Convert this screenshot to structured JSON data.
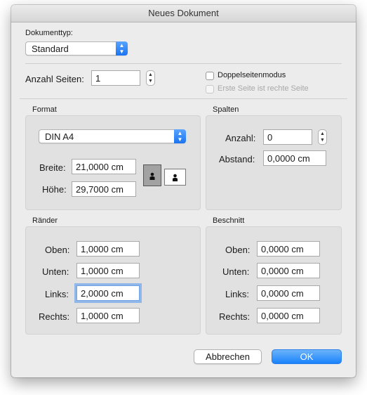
{
  "window": {
    "title": "Neues Dokument"
  },
  "doc_type": {
    "label": "Dokumenttyp:",
    "value": "Standard"
  },
  "pages": {
    "label": "Anzahl Seiten:",
    "value": "1"
  },
  "options": {
    "facing_pages": "Doppelseitenmodus",
    "first_page_right": "Erste Seite ist rechte Seite"
  },
  "format": {
    "title": "Format",
    "size": "DIN A4",
    "width_label": "Breite:",
    "width": "21,0000 cm",
    "height_label": "Höhe:",
    "height": "29,7000 cm"
  },
  "columns": {
    "title": "Spalten",
    "count_label": "Anzahl:",
    "count": "0",
    "gap_label": "Abstand:",
    "gap": "0,0000 cm"
  },
  "margins": {
    "title": "Ränder",
    "top_label": "Oben:",
    "top": "1,0000 cm",
    "bottom_label": "Unten:",
    "bottom": "1,0000 cm",
    "left_label": "Links:",
    "left": "2,0000 cm",
    "right_label": "Rechts:",
    "right": "1,0000 cm"
  },
  "bleed": {
    "title": "Beschnitt",
    "top_label": "Oben:",
    "top": "0,0000 cm",
    "bottom_label": "Unten:",
    "bottom": "0,0000 cm",
    "left_label": "Links:",
    "left": "0,0000 cm",
    "right_label": "Rechts:",
    "right": "0,0000 cm"
  },
  "buttons": {
    "cancel": "Abbrechen",
    "ok": "OK"
  },
  "colors": {
    "accent": "#1a82fb",
    "focus_ring": "#5096f0"
  }
}
